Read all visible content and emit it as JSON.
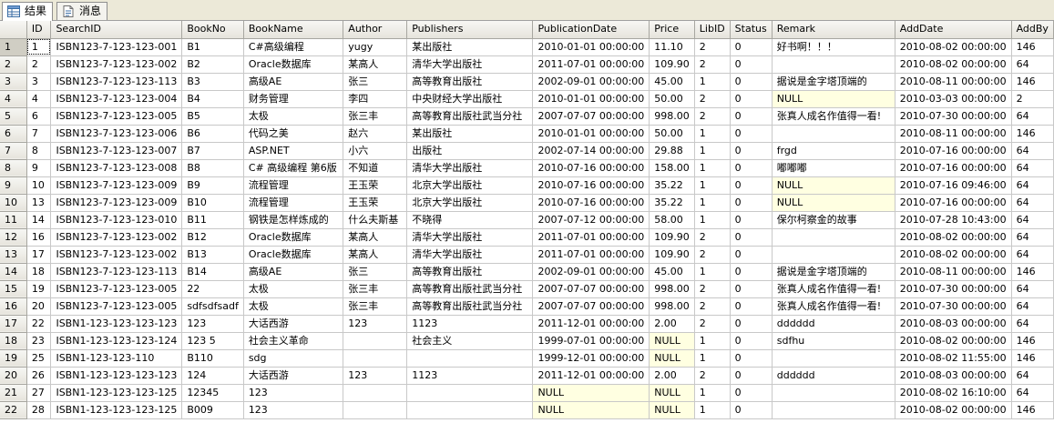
{
  "tabs": [
    {
      "label": "结果",
      "icon": "grid-icon",
      "active": true
    },
    {
      "label": "消息",
      "icon": "message-icon",
      "active": false
    }
  ],
  "columns": [
    "",
    "ID",
    "SearchID",
    "BookNo",
    "BookName",
    "Author",
    "Publishers",
    "PublicationDate",
    "Price",
    "LibID",
    "Status",
    "Remark",
    "AddDate",
    "AddBy"
  ],
  "rows": [
    [
      "1",
      "1",
      "ISBN123-7-123-123-001",
      "B1",
      "C#高级编程",
      "yugy",
      "某出版社",
      "2010-01-01 00:00:00",
      "11.10",
      "2",
      "0",
      "好书啊！！！",
      "2010-08-02 00:00:00",
      "146"
    ],
    [
      "2",
      "2",
      "ISBN123-7-123-123-002",
      "B2",
      "Oracle数据库",
      "某高人",
      "清华大学出版社",
      "2011-07-01 00:00:00",
      "109.90",
      "2",
      "0",
      "",
      "2010-08-02 00:00:00",
      "64"
    ],
    [
      "3",
      "3",
      "ISBN123-7-123-123-113",
      "B3",
      "高级AE",
      "张三",
      "高等教育出版社",
      "2002-09-01 00:00:00",
      "45.00",
      "1",
      "0",
      "据说是金字塔顶端的",
      "2010-08-11 00:00:00",
      "146"
    ],
    [
      "4",
      "4",
      "ISBN123-7-123-123-004",
      "B4",
      "财务管理",
      "李四",
      "中央财经大学出版社",
      "2010-01-01 00:00:00",
      "50.00",
      "2",
      "0",
      "NULL",
      "2010-03-03 00:00:00",
      "2"
    ],
    [
      "5",
      "6",
      "ISBN123-7-123-123-005",
      "B5",
      "太极",
      "张三丰",
      "高等教育出版社武当分社",
      "2007-07-07 00:00:00",
      "998.00",
      "2",
      "0",
      "张真人成名作值得一看!",
      "2010-07-30 00:00:00",
      "64"
    ],
    [
      "6",
      "7",
      "ISBN123-7-123-123-006",
      "B6",
      "代码之美",
      "赵六",
      "某出版社",
      "2010-01-01 00:00:00",
      "50.00",
      "1",
      "0",
      "",
      "2010-08-11 00:00:00",
      "146"
    ],
    [
      "7",
      "8",
      "ISBN123-7-123-123-007",
      "B7",
      "ASP.NET",
      "小六",
      "出版社",
      "2002-07-14 00:00:00",
      "29.88",
      "1",
      "0",
      "frgd",
      "2010-07-16 00:00:00",
      "64"
    ],
    [
      "8",
      "9",
      "ISBN123-7-123-123-008",
      "B8",
      "C# 高级编程 第6版",
      "不知道",
      "清华大学出版社",
      "2010-07-16 00:00:00",
      "158.00",
      "1",
      "0",
      "嘟嘟嘟",
      "2010-07-16 00:00:00",
      "64"
    ],
    [
      "9",
      "10",
      "ISBN123-7-123-123-009",
      "B9",
      "流程管理",
      "王玉荣",
      "北京大学出版社",
      "2010-07-16 00:00:00",
      "35.22",
      "1",
      "0",
      "NULL",
      "2010-07-16 09:46:00",
      "64"
    ],
    [
      "10",
      "13",
      "ISBN123-7-123-123-009",
      "B10",
      "流程管理",
      "王玉荣",
      "北京大学出版社",
      "2010-07-16 00:00:00",
      "35.22",
      "1",
      "0",
      "NULL",
      "2010-07-16 00:00:00",
      "64"
    ],
    [
      "11",
      "14",
      "ISBN123-7-123-123-010",
      "B11",
      "钢铁是怎样炼成的",
      "什么夫斯基",
      "不晓得",
      "2007-07-12 00:00:00",
      "58.00",
      "1",
      "0",
      "保尔柯察金的故事",
      "2010-07-28 10:43:00",
      "64"
    ],
    [
      "12",
      "16",
      "ISBN123-7-123-123-002",
      "B12",
      "Oracle数据库",
      "某高人",
      "清华大学出版社",
      "2011-07-01 00:00:00",
      "109.90",
      "2",
      "0",
      "",
      "2010-08-02 00:00:00",
      "64"
    ],
    [
      "13",
      "17",
      "ISBN123-7-123-123-002",
      "B13",
      "Oracle数据库",
      "某高人",
      "清华大学出版社",
      "2011-07-01 00:00:00",
      "109.90",
      "2",
      "0",
      "",
      "2010-08-02 00:00:00",
      "64"
    ],
    [
      "14",
      "18",
      "ISBN123-7-123-123-113",
      "B14",
      "高级AE",
      "张三",
      "高等教育出版社",
      "2002-09-01 00:00:00",
      "45.00",
      "1",
      "0",
      "据说是金字塔顶端的",
      "2010-08-11 00:00:00",
      "146"
    ],
    [
      "15",
      "19",
      "ISBN123-7-123-123-005",
      "22",
      "太极",
      "张三丰",
      "高等教育出版社武当分社",
      "2007-07-07 00:00:00",
      "998.00",
      "2",
      "0",
      "张真人成名作值得一看!",
      "2010-07-30 00:00:00",
      "64"
    ],
    [
      "16",
      "20",
      "ISBN123-7-123-123-005",
      "sdfsdfsadf",
      "太极",
      "张三丰",
      "高等教育出版社武当分社",
      "2007-07-07 00:00:00",
      "998.00",
      "2",
      "0",
      "张真人成名作值得一看!",
      "2010-07-30 00:00:00",
      "64"
    ],
    [
      "17",
      "22",
      "ISBN1-123-123-123-123",
      "123",
      "大话西游",
      "123",
      "1123",
      "2011-12-01 00:00:00",
      "2.00",
      "2",
      "0",
      "dddddd",
      "2010-08-03 00:00:00",
      "64"
    ],
    [
      "18",
      "23",
      "ISBN1-123-123-123-124",
      "123 5",
      "社会主义革命",
      "",
      "社会主义",
      "1999-07-01 00:00:00",
      "NULL",
      "1",
      "0",
      "sdfhu",
      "2010-08-02 00:00:00",
      "146"
    ],
    [
      "19",
      "25",
      "ISBN1-123-123-110",
      "B110",
      "sdg",
      "",
      "",
      "1999-12-01 00:00:00",
      "NULL",
      "1",
      "0",
      "",
      "2010-08-02 11:55:00",
      "146"
    ],
    [
      "20",
      "26",
      "ISBN1-123-123-123-123",
      "124",
      "大话西游",
      "123",
      "1123",
      "2011-12-01 00:00:00",
      "2.00",
      "2",
      "0",
      "dddddd",
      "2010-08-03 00:00:00",
      "64"
    ],
    [
      "21",
      "27",
      "ISBN1-123-123-123-125",
      "12345",
      "123",
      "",
      "",
      "NULL",
      "NULL",
      "1",
      "0",
      "",
      "2010-08-02 16:10:00",
      "64"
    ],
    [
      "22",
      "28",
      "ISBN1-123-123-123-125",
      "B009",
      "123",
      "",
      "",
      "NULL",
      "NULL",
      "1",
      "0",
      "",
      "2010-08-02 00:00:00",
      "146"
    ]
  ],
  "colors": {
    "null_cell": "#ffffe1",
    "header_bg": "#e6e4dc",
    "tabbar_bg": "#ece9d8"
  }
}
